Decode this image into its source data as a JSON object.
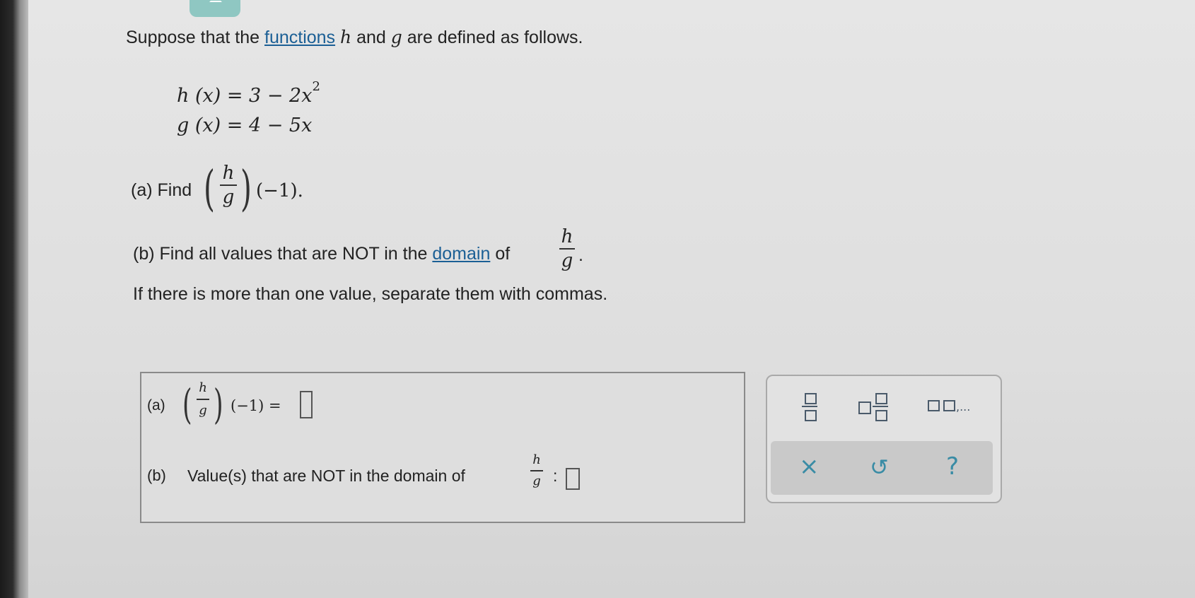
{
  "question": {
    "intro_before": "Suppose that the",
    "intro_link": "functions",
    "intro_h": "h",
    "intro_and": "and",
    "intro_g": "g",
    "intro_after": "are defined as follows.",
    "eq_h": "h (x) = 3 − 2x",
    "eq_h_exp": "2",
    "eq_g": "g (x) = 4 − 5x",
    "part_a_label": "(a) Find",
    "part_a_arg": "(−1).",
    "part_b_before": "(b) Find all values that are NOT in the",
    "part_b_link": "domain",
    "part_b_of": "of",
    "part_b_dot": ".",
    "part_b_note": "If there is more than one value, separate them with commas.",
    "frac_num": "h",
    "frac_den": "g"
  },
  "answer": {
    "a_label": "(a)",
    "a_arg": "(−1) =",
    "b_label": "(b)",
    "b_text": "Value(s) that are NOT in the domain of",
    "b_colon": ":"
  },
  "toolbar": {
    "fraction_icon": "fraction-icon",
    "mixed_number_icon": "mixed-number-icon",
    "list_icon": "list-icon",
    "list_ellipsis": ",...",
    "clear_symbol": "×",
    "undo_symbol": "↺",
    "help_symbol": "?"
  }
}
